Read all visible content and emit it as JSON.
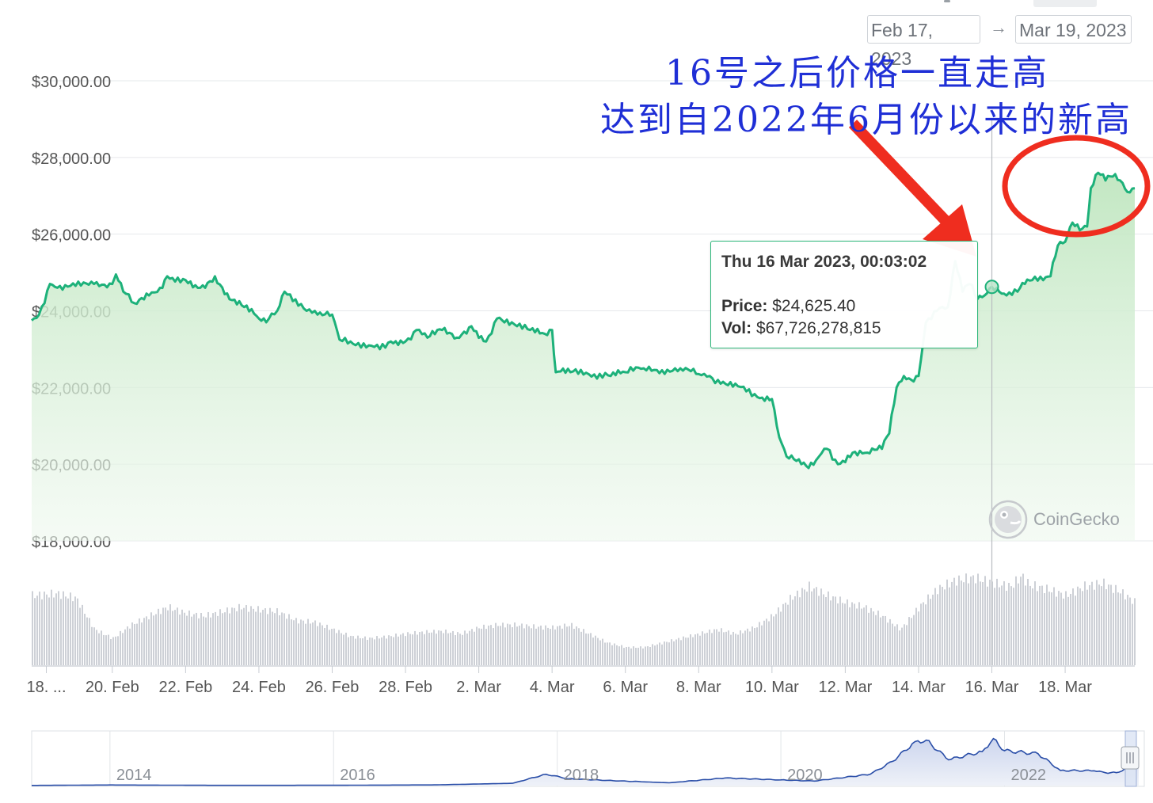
{
  "date_range": {
    "start": "Feb 17, 2023",
    "arrow": "→",
    "end": "Mar 19, 2023"
  },
  "annotation": {
    "line1": "16号之后价格一直走高",
    "line2": "达到自2022年6月份以来的新高"
  },
  "tooltip": {
    "date": "Thu 16 Mar 2023, 00:03:02",
    "price_label": "Price:",
    "price_value": "$24,625.40",
    "vol_label": "Vol:",
    "vol_value": "$67,726,278,815"
  },
  "watermark": "CoinGecko",
  "colors": {
    "line": "#1db17a",
    "area_top": "#cdebcd",
    "volume": "#cdd0d6",
    "annotation": "#1f2fd6",
    "arrow_and_circle": "#ef2d1f",
    "navigator_line": "#2a4ea8"
  },
  "chart_data": [
    {
      "type": "line",
      "ylim": [
        18000,
        30000
      ],
      "y_ticks": [
        "$18,000.00",
        "$20,000.00",
        "$22,000.00",
        "$24,000.00",
        "$26,000.00",
        "$28,000.00",
        "$30,000.00"
      ],
      "y_tick_values": [
        18000,
        20000,
        22000,
        24000,
        26000,
        28000,
        30000
      ],
      "x_ticks": [
        "18. ...",
        "20. Feb",
        "22. Feb",
        "24. Feb",
        "26. Feb",
        "28. Feb",
        "2. Mar",
        "4. Mar",
        "6. Mar",
        "8. Mar",
        "10. Mar",
        "12. Mar",
        "14. Mar",
        "16. Mar",
        "18. Mar"
      ],
      "x_tick_days": [
        1.2,
        3,
        5,
        7,
        9,
        11,
        13,
        15,
        17,
        19,
        21,
        23,
        25,
        27,
        29
      ],
      "x_range_days": [
        0.8,
        30.9
      ],
      "series": [
        {
          "price_points": [
            [
              0.8,
              23750
            ],
            [
              1.0,
              23900
            ],
            [
              1.3,
              24700
            ],
            [
              1.5,
              24600
            ],
            [
              2.0,
              24650
            ],
            [
              2.5,
              24700
            ],
            [
              3.0,
              24700
            ],
            [
              3.1,
              24950
            ],
            [
              3.3,
              24500
            ],
            [
              3.6,
              24200
            ],
            [
              4.0,
              24400
            ],
            [
              4.3,
              24600
            ],
            [
              4.5,
              24900
            ],
            [
              5.0,
              24800
            ],
            [
              5.4,
              24600
            ],
            [
              5.8,
              24900
            ],
            [
              6.2,
              24300
            ],
            [
              6.6,
              24100
            ],
            [
              7.0,
              23800
            ],
            [
              7.2,
              23700
            ],
            [
              7.5,
              24000
            ],
            [
              7.7,
              24500
            ],
            [
              8.0,
              24300
            ],
            [
              8.3,
              24000
            ],
            [
              8.6,
              23900
            ],
            [
              9.0,
              23900
            ],
            [
              9.2,
              23250
            ],
            [
              9.5,
              23200
            ],
            [
              10.0,
              23100
            ],
            [
              10.3,
              23000
            ],
            [
              10.6,
              23200
            ],
            [
              11.0,
              23200
            ],
            [
              11.3,
              23500
            ],
            [
              11.6,
              23300
            ],
            [
              12.0,
              23500
            ],
            [
              12.4,
              23300
            ],
            [
              12.8,
              23600
            ],
            [
              13.2,
              23200
            ],
            [
              13.5,
              23800
            ],
            [
              13.9,
              23700
            ],
            [
              14.4,
              23500
            ],
            [
              14.8,
              23400
            ],
            [
              15.0,
              23500
            ],
            [
              15.1,
              22400
            ],
            [
              15.5,
              22400
            ],
            [
              16.0,
              22350
            ],
            [
              16.6,
              22300
            ],
            [
              17.0,
              22400
            ],
            [
              17.5,
              22500
            ],
            [
              18.0,
              22450
            ],
            [
              18.5,
              22500
            ],
            [
              19.0,
              22350
            ],
            [
              19.3,
              22300
            ],
            [
              19.6,
              22100
            ],
            [
              20.0,
              22100
            ],
            [
              20.3,
              21900
            ],
            [
              20.6,
              21750
            ],
            [
              21.0,
              21700
            ],
            [
              21.2,
              20700
            ],
            [
              21.4,
              20200
            ],
            [
              21.8,
              20000
            ],
            [
              22.0,
              19900
            ],
            [
              22.2,
              20100
            ],
            [
              22.5,
              20400
            ],
            [
              22.8,
              20000
            ],
            [
              23.2,
              20300
            ],
            [
              23.6,
              20300
            ],
            [
              24.0,
              20400
            ],
            [
              24.2,
              20800
            ],
            [
              24.4,
              22000
            ],
            [
              24.6,
              22300
            ],
            [
              24.8,
              22200
            ],
            [
              25.0,
              22300
            ],
            [
              25.2,
              23700
            ],
            [
              25.5,
              24000
            ],
            [
              25.8,
              24100
            ],
            [
              26.0,
              25300
            ],
            [
              26.2,
              24500
            ],
            [
              26.4,
              24700
            ],
            [
              26.6,
              24300
            ],
            [
              26.8,
              24400
            ],
            [
              27.0,
              24625
            ],
            [
              27.2,
              24500
            ],
            [
              27.4,
              24400
            ],
            [
              27.7,
              24500
            ],
            [
              27.9,
              24700
            ],
            [
              28.1,
              24800
            ],
            [
              28.4,
              24800
            ],
            [
              28.6,
              24900
            ],
            [
              28.8,
              25700
            ],
            [
              29.0,
              25800
            ],
            [
              29.2,
              26300
            ],
            [
              29.4,
              26100
            ],
            [
              29.6,
              26200
            ],
            [
              29.7,
              27200
            ],
            [
              29.9,
              27600
            ],
            [
              30.1,
              27400
            ],
            [
              30.3,
              27500
            ],
            [
              30.5,
              27400
            ],
            [
              30.7,
              27100
            ],
            [
              30.9,
              27200
            ]
          ]
        }
      ],
      "volume_relative": [
        [
          0.8,
          0.78
        ],
        [
          1.5,
          0.8
        ],
        [
          2.0,
          0.75
        ],
        [
          2.5,
          0.4
        ],
        [
          3.0,
          0.3
        ],
        [
          3.5,
          0.45
        ],
        [
          4.0,
          0.55
        ],
        [
          4.5,
          0.65
        ],
        [
          5.0,
          0.58
        ],
        [
          5.5,
          0.55
        ],
        [
          6.0,
          0.6
        ],
        [
          6.5,
          0.65
        ],
        [
          7.0,
          0.62
        ],
        [
          7.5,
          0.6
        ],
        [
          8.0,
          0.5
        ],
        [
          8.5,
          0.48
        ],
        [
          9.0,
          0.4
        ],
        [
          9.5,
          0.32
        ],
        [
          10.0,
          0.3
        ],
        [
          10.5,
          0.32
        ],
        [
          11.0,
          0.35
        ],
        [
          11.5,
          0.37
        ],
        [
          12.0,
          0.38
        ],
        [
          12.5,
          0.35
        ],
        [
          13.0,
          0.42
        ],
        [
          13.5,
          0.45
        ],
        [
          14.0,
          0.45
        ],
        [
          14.5,
          0.43
        ],
        [
          15.0,
          0.42
        ],
        [
          15.5,
          0.45
        ],
        [
          16.0,
          0.35
        ],
        [
          16.5,
          0.25
        ],
        [
          17.0,
          0.2
        ],
        [
          17.5,
          0.2
        ],
        [
          18.0,
          0.25
        ],
        [
          18.5,
          0.3
        ],
        [
          19.0,
          0.35
        ],
        [
          19.5,
          0.4
        ],
        [
          20.0,
          0.35
        ],
        [
          20.5,
          0.42
        ],
        [
          21.0,
          0.55
        ],
        [
          21.5,
          0.75
        ],
        [
          22.0,
          0.88
        ],
        [
          22.5,
          0.78
        ],
        [
          23.0,
          0.7
        ],
        [
          23.5,
          0.65
        ],
        [
          24.0,
          0.55
        ],
        [
          24.5,
          0.4
        ],
        [
          25.0,
          0.65
        ],
        [
          25.5,
          0.85
        ],
        [
          26.0,
          0.95
        ],
        [
          26.5,
          0.98
        ],
        [
          27.0,
          0.92
        ],
        [
          27.5,
          0.88
        ],
        [
          27.8,
          1.0
        ],
        [
          28.0,
          0.9
        ],
        [
          28.5,
          0.85
        ],
        [
          29.0,
          0.78
        ],
        [
          29.5,
          0.88
        ],
        [
          30.0,
          0.92
        ],
        [
          30.5,
          0.82
        ],
        [
          30.9,
          0.7
        ]
      ]
    },
    {
      "type": "area",
      "name": "navigator",
      "x_ticks": [
        "2014",
        "2016",
        "2018",
        "2020",
        "2022"
      ],
      "x_tick_years": [
        2014,
        2016,
        2018,
        2020,
        2022
      ],
      "x_range_years": [
        2013.3,
        2023.25
      ],
      "y_range": [
        0,
        69000
      ],
      "price_points": [
        [
          2013.3,
          200
        ],
        [
          2014.0,
          800
        ],
        [
          2015.0,
          300
        ],
        [
          2016.0,
          400
        ],
        [
          2016.9,
          900
        ],
        [
          2017.6,
          3000
        ],
        [
          2017.9,
          15000
        ],
        [
          2018.1,
          9000
        ],
        [
          2018.5,
          6500
        ],
        [
          2019.0,
          3700
        ],
        [
          2019.5,
          10000
        ],
        [
          2020.0,
          7500
        ],
        [
          2020.3,
          6000
        ],
        [
          2020.8,
          15000
        ],
        [
          2021.0,
          32000
        ],
        [
          2021.2,
          58000
        ],
        [
          2021.3,
          60000
        ],
        [
          2021.5,
          34000
        ],
        [
          2021.8,
          45000
        ],
        [
          2021.9,
          62000
        ],
        [
          2022.0,
          46000
        ],
        [
          2022.3,
          42000
        ],
        [
          2022.5,
          20000
        ],
        [
          2022.8,
          19500
        ],
        [
          2022.9,
          17000
        ],
        [
          2023.0,
          17000
        ],
        [
          2023.1,
          23000
        ],
        [
          2023.2,
          27000
        ]
      ]
    }
  ]
}
